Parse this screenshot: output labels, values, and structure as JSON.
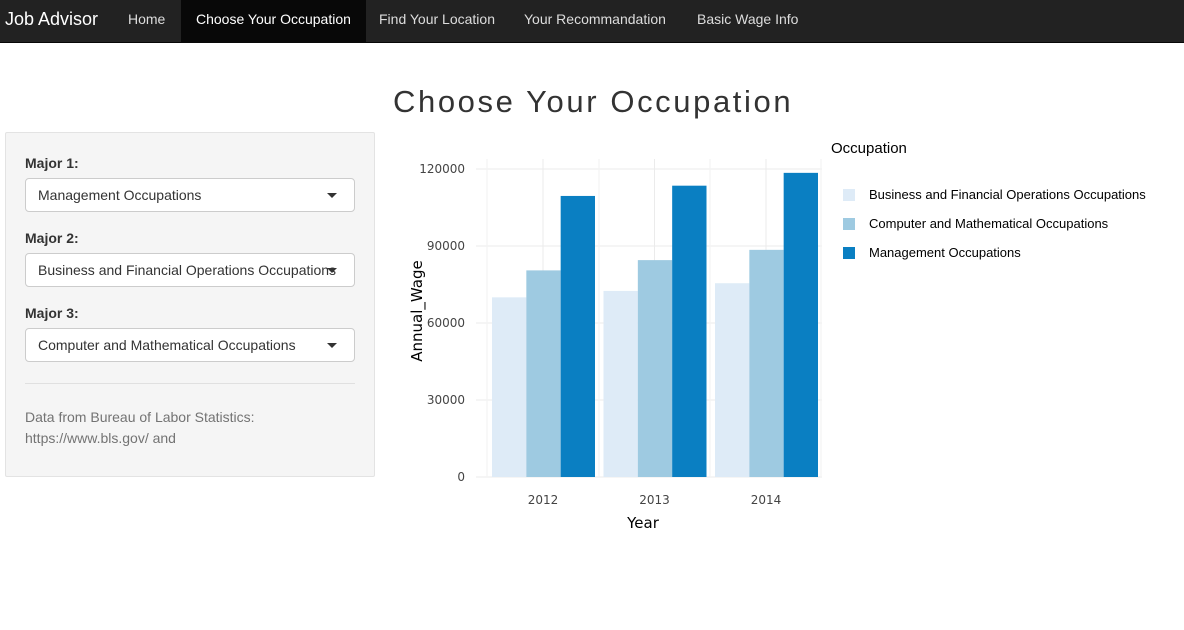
{
  "navbar": {
    "brand": "Job Advisor",
    "items": [
      {
        "label": "Home",
        "active": false
      },
      {
        "label": "Choose Your Occupation",
        "active": true
      },
      {
        "label": "Find Your Location",
        "active": false
      },
      {
        "label": "Your Recommandation",
        "active": false
      },
      {
        "label": "Basic Wage Info",
        "active": false
      }
    ]
  },
  "page": {
    "title": "Choose Your Occupation"
  },
  "sidebar": {
    "major1": {
      "label": "Major 1:",
      "value": "Management Occupations"
    },
    "major2": {
      "label": "Major 2:",
      "value": "Business and Financial Operations Occupations"
    },
    "major3": {
      "label": "Major 3:",
      "value": "Computer and Mathematical Occupations"
    },
    "note_line1": "Data from Bureau of Labor Statistics:",
    "note_line2": "https://www.bls.gov/ and"
  },
  "chart_data": {
    "type": "bar",
    "xlabel": "Year",
    "ylabel": "Annual_Wage",
    "categories": [
      "2012",
      "2013",
      "2014"
    ],
    "ylim": [
      0,
      120000
    ],
    "yticks": [
      "0",
      "30000",
      "60000",
      "90000",
      "120000"
    ],
    "grid": true,
    "legend_title": "Occupation",
    "legend_position": "right",
    "series": [
      {
        "name": "Business and Financial Operations Occupations",
        "values": [
          70000,
          72500,
          75500
        ],
        "color": "#deebf7"
      },
      {
        "name": "Computer and Mathematical Occupations",
        "values": [
          80500,
          84500,
          88500
        ],
        "color": "#9ecae1"
      },
      {
        "name": "Management Occupations",
        "values": [
          109500,
          113500,
          118500
        ],
        "color": "#0a7fc2"
      }
    ]
  }
}
